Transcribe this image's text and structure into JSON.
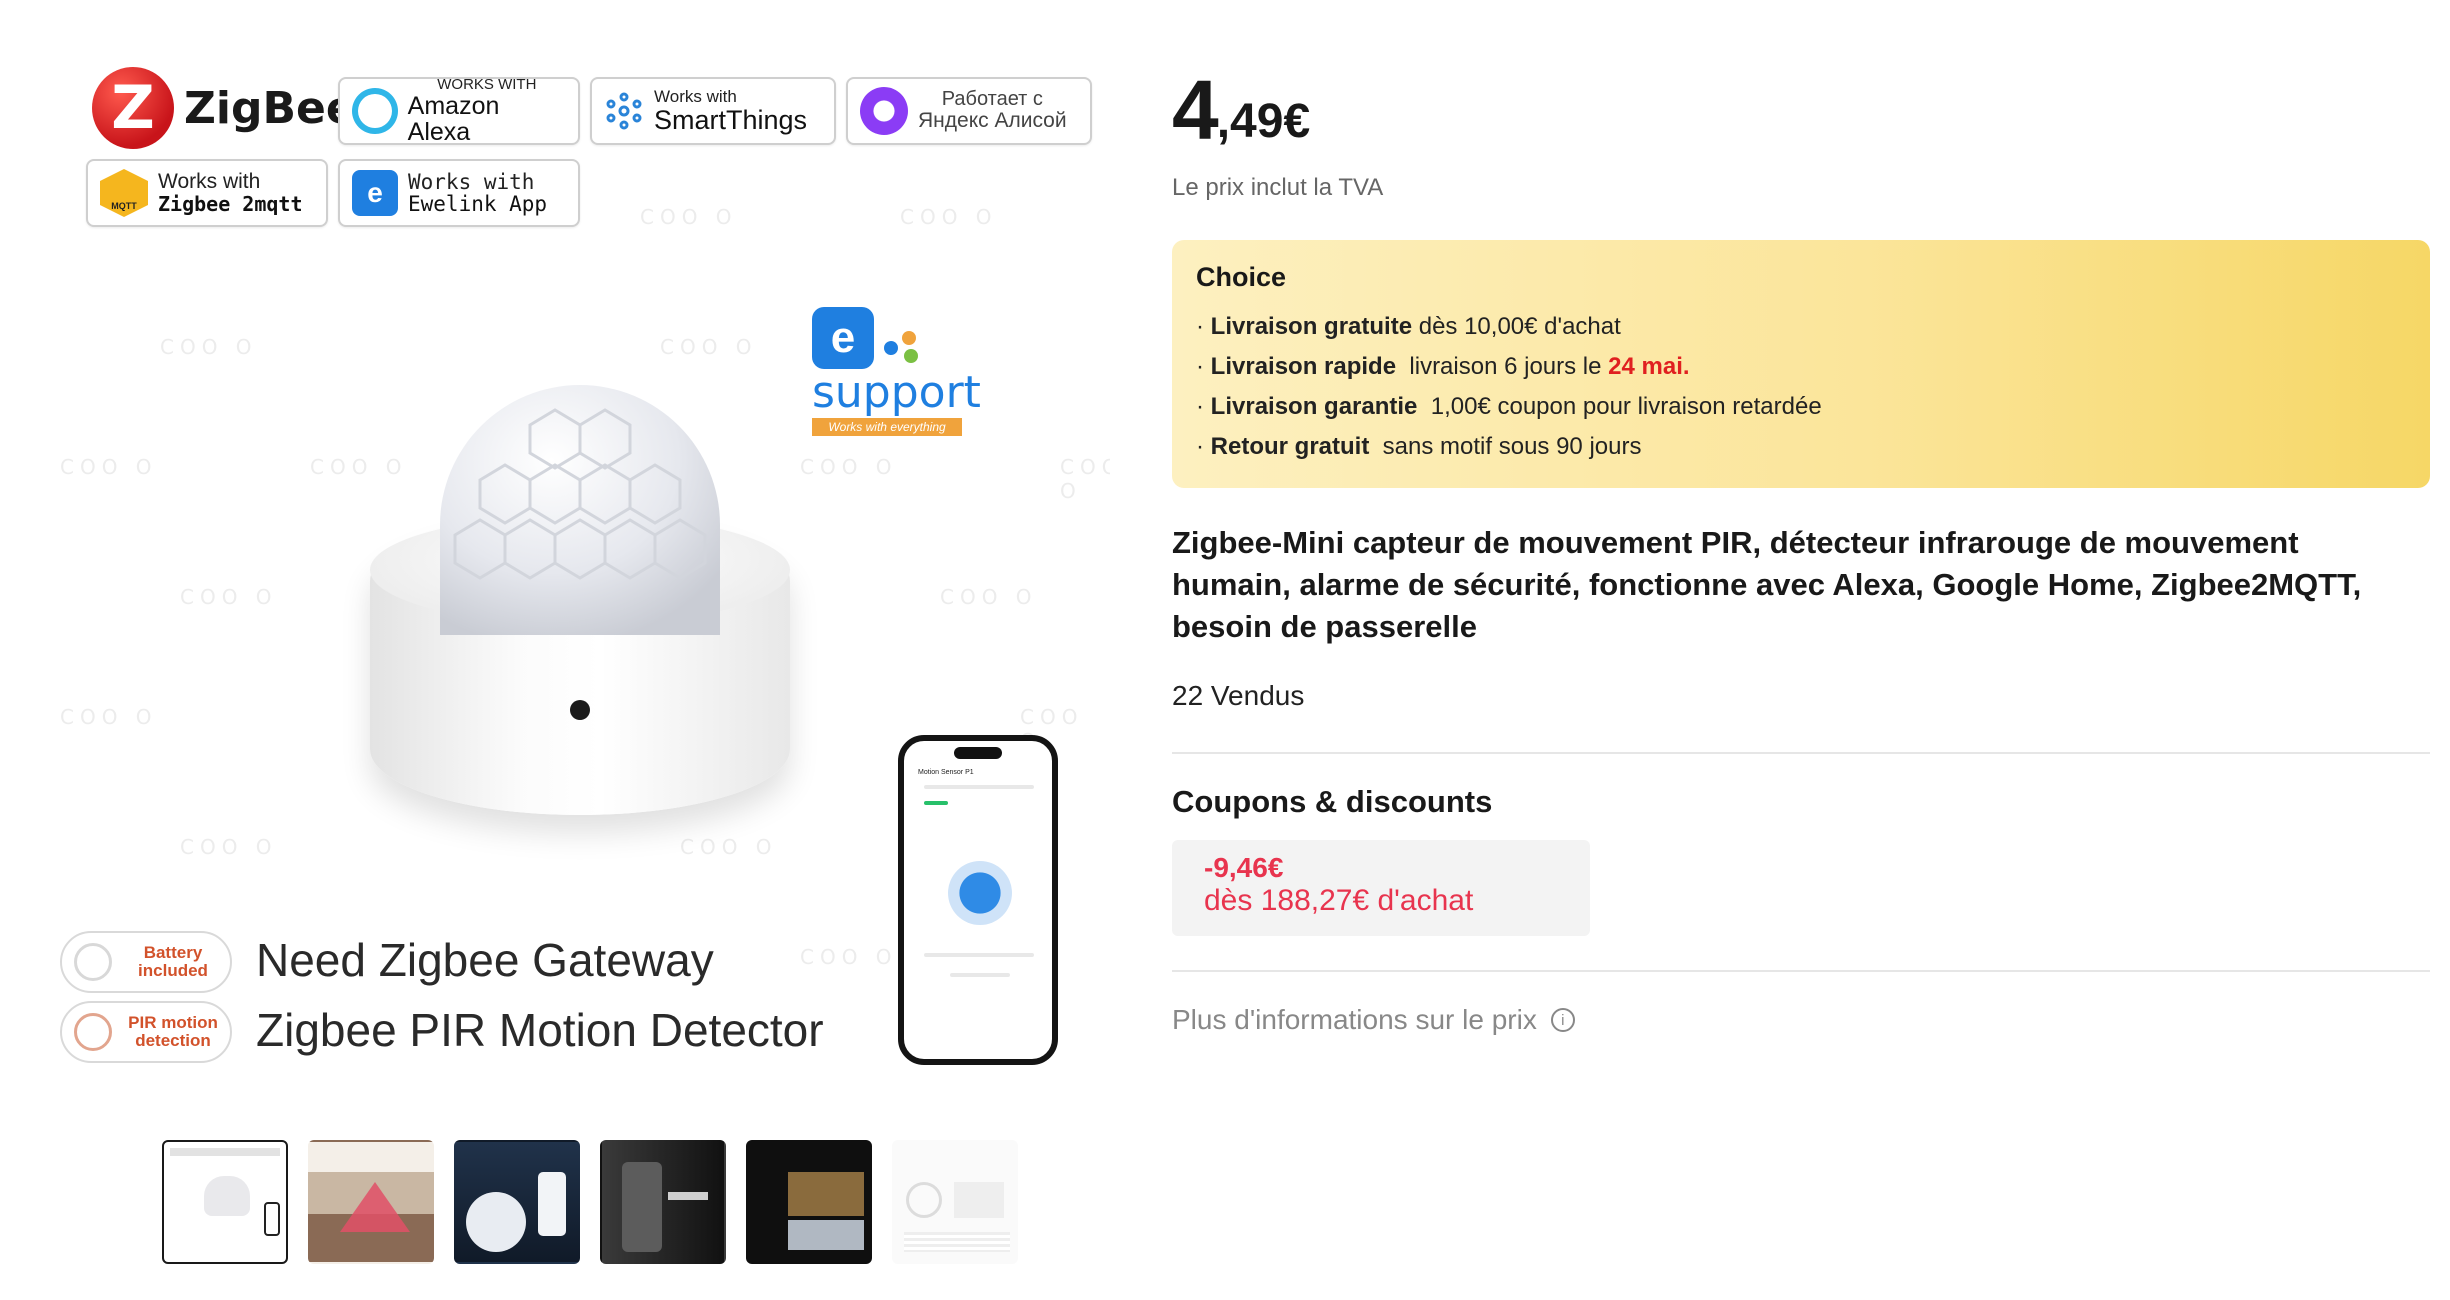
{
  "product": {
    "price_int": "4",
    "price_dec": ",49€",
    "vat_note": "Le prix inclut la TVA",
    "title": "Zigbee-Mini capteur de mouvement PIR, détecteur infrarouge de mouvement humain, alarme de sécurité, fonctionne avec Alexa, Google Home, Zigbee2MQTT, besoin de passerelle",
    "sold": "22 Vendus"
  },
  "choice": {
    "title": "Choice",
    "rows": [
      {
        "bold": "Livraison gratuite",
        "text": " dès 10,00€ d'achat",
        "highlight": ""
      },
      {
        "bold": "Livraison rapide",
        "text": "  livraison 6 jours le ",
        "highlight": "24 mai."
      },
      {
        "bold": "Livraison garantie",
        "text": "  1,00€ coupon pour livraison retardée",
        "highlight": ""
      },
      {
        "bold": "Retour gratuit",
        "text": "  sans motif sous 90 jours",
        "highlight": ""
      }
    ]
  },
  "coupons": {
    "title": "Coupons & discounts",
    "amount": "-9,46€",
    "condition": "dès 188,27€ d'achat"
  },
  "more_info": "Plus d'informations sur le prix",
  "image": {
    "zigbee_word": "ZigBee",
    "badges": {
      "alexa_small": "WORKS WITH",
      "alexa_big": "Amazon Alexa",
      "st_small": "Works with",
      "st_big": "SmartThings",
      "yandex_line1": "Работает с",
      "yandex_line2": "Яндекс Алисой",
      "z2m_line1": "Works with",
      "z2m_line2": "Zigbee 2mqtt",
      "z2m_icon_text": "MQTT",
      "ewl_line1": "Works with",
      "ewl_line2": "Ewelink App"
    },
    "ewelink": {
      "letter": "e",
      "support": "support",
      "tag": "Works with everything"
    },
    "features": [
      {
        "pill": "Battery included",
        "line": "Need Zigbee Gateway"
      },
      {
        "pill": "PIR motion detection",
        "line": "Zigbee PIR Motion Detector"
      }
    ],
    "phone_title": "Motion Sensor P1"
  },
  "thumbnails": [
    "thumb-1",
    "thumb-2",
    "thumb-3",
    "thumb-4",
    "thumb-5",
    "thumb-6"
  ],
  "colors": {
    "accent_red": "#e02020",
    "coupon_red": "#e8344e",
    "choice_bg": "#fbe59a",
    "ewelink_blue": "#1f7fe0"
  }
}
